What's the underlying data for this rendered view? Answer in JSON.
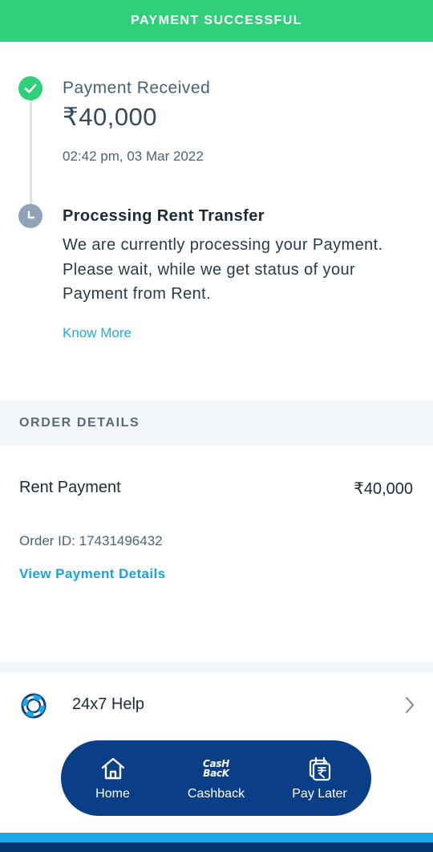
{
  "banner": {
    "title": "PAYMENT SUCCESSFUL"
  },
  "timeline": {
    "received": {
      "title": "Payment Received",
      "amount": "₹40,000",
      "time": "02:42 pm, 03 Mar 2022"
    },
    "processing": {
      "title": "Processing Rent Transfer",
      "description": "We are currently processing your Payment. Please wait, while we get status of your Payment from Rent.",
      "link": "Know More"
    }
  },
  "order": {
    "header": "ORDER DETAILS",
    "item_label": "Rent Payment",
    "item_amount": "₹40,000",
    "order_id": "Order ID: 17431496432",
    "details_link": "View Payment Details"
  },
  "help": {
    "label": "24x7 Help",
    "icon": "lifebuoy-icon"
  },
  "nav": {
    "items": [
      {
        "label": "Home",
        "icon": "home-icon"
      },
      {
        "label": "Cashback",
        "icon": "cashback-icon",
        "glyph": "CasH BacK"
      },
      {
        "label": "Pay Later",
        "icon": "calendar-rupee-icon"
      }
    ]
  },
  "colors": {
    "success": "#2fcf7c",
    "accent_link": "#17b0e0",
    "nav_bg": "#0a3f87"
  }
}
